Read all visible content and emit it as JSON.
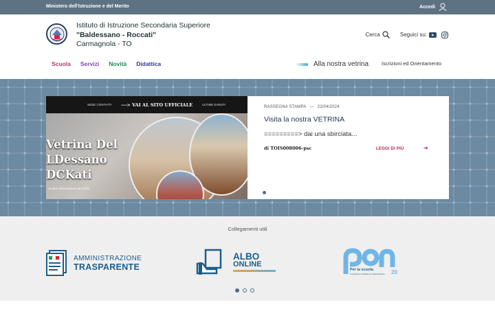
{
  "topbar": {
    "ministry": "Ministero dell'Istruzione e del Merito",
    "login": "Accedi"
  },
  "header": {
    "line1": "Istituto di Istruzione Secondaria Superiore",
    "line2": "\"Baldessano - Roccati\"",
    "line3": "Carmagnola - TO",
    "search_label": "Cerca",
    "follow_label": "Seguici su:"
  },
  "nav": {
    "items": [
      "Scuola",
      "Servizi",
      "Novità",
      "Didattica"
    ],
    "vetrina": "Alla nostra vetrina",
    "iscrizioni": "Iscrizioni ed Orientamento"
  },
  "hero": {
    "image_bar": [
      "SEDE CONTATTI",
      "---> VAI AL SITO UFFICIALE",
      "ULTIME EVENTI"
    ],
    "image_text": [
      "Vetrina Del",
      "LDessano",
      "DCKati"
    ],
    "image_small": "le altre informazioni vai al sito",
    "category": "RASSEGNA STAMPA",
    "date": "22/04/2024",
    "title": "Visita la nostra VETRINA",
    "desc": "=========> dai una sbirciata...",
    "author": "di TOIS008006-psc",
    "readmore": "LEGGI DI PIÙ"
  },
  "links": {
    "heading": "Collegamenti utili",
    "amm_line1": "AMMINISTRAZIONE",
    "amm_line2": "TRASPARENTE",
    "albo_line1": "ALBO",
    "albo_line2": "ONLINE",
    "pon_text": "Per la scuola",
    "pon_sub": "competenze e ambienti per l'apprendimento",
    "pon_year": "20"
  },
  "colors": {
    "topbar": "#5d7283",
    "hero": "#6c8aa2",
    "accent": "#b0203a",
    "brand_blue": "#1c5d8a"
  }
}
